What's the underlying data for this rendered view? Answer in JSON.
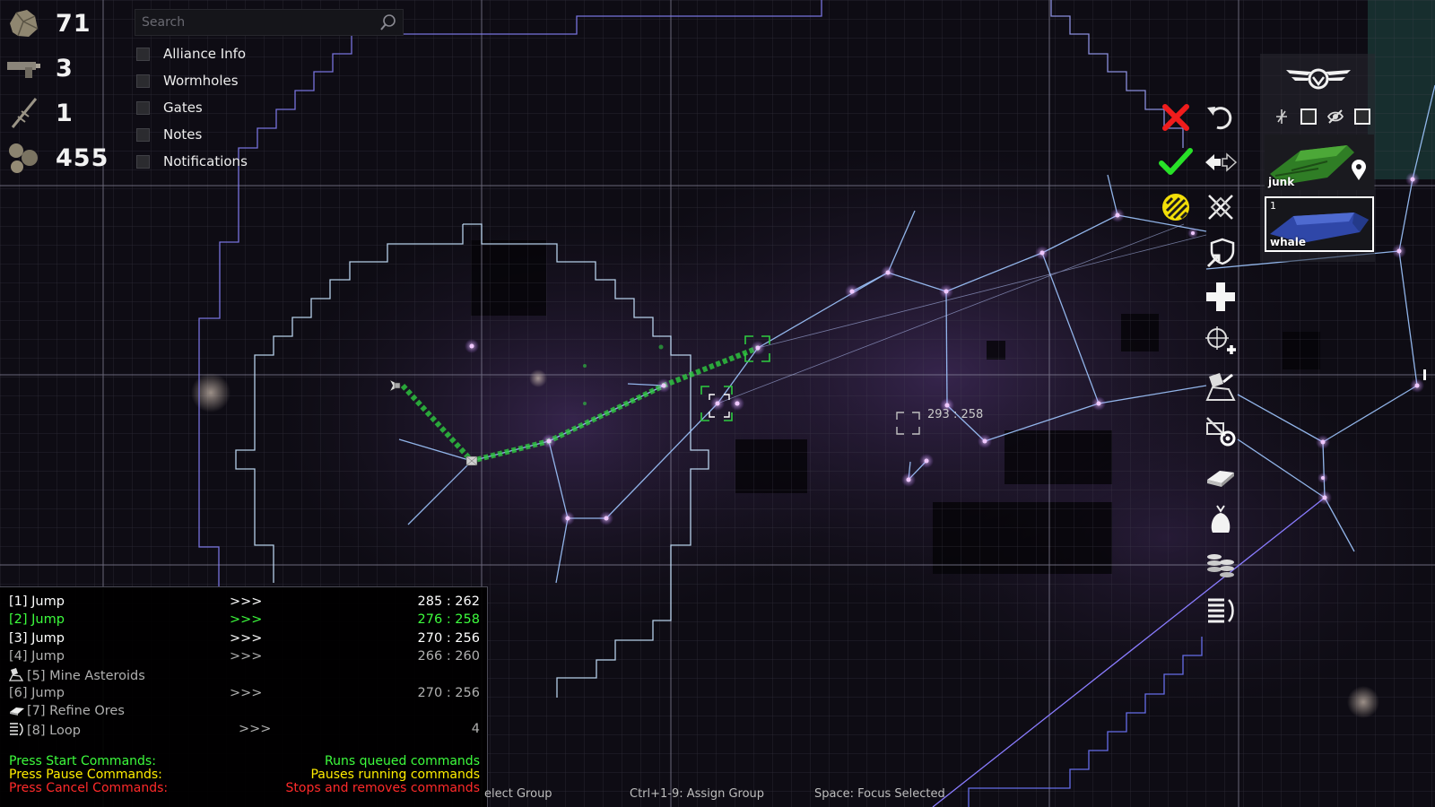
{
  "resources": [
    {
      "icon": "ore-icon",
      "value": "71"
    },
    {
      "icon": "weapon-icon",
      "value": "3"
    },
    {
      "icon": "antenna-icon",
      "value": "1"
    },
    {
      "icon": "rocks-icon",
      "value": "455"
    }
  ],
  "search": {
    "placeholder": "Search"
  },
  "filters": [
    "Alliance Info",
    "Wormholes",
    "Gates",
    "Notes",
    "Notifications"
  ],
  "commands": [
    {
      "label": "[1] Jump",
      "arrows": ">>>",
      "coords": "285 : 262",
      "color": "#ffffff",
      "icon": ""
    },
    {
      "label": "[2] Jump",
      "arrows": ">>>",
      "coords": "276 : 258",
      "color": "#3dfc3d",
      "icon": ""
    },
    {
      "label": "[3] Jump",
      "arrows": ">>>",
      "coords": "270 : 256",
      "color": "#ffffff",
      "icon": ""
    },
    {
      "label": "[4] Jump",
      "arrows": ">>>",
      "coords": "266 : 260",
      "color": "#b0b0b0",
      "icon": ""
    },
    {
      "label": "[5] Mine Asteroids",
      "arrows": "",
      "coords": "",
      "color": "#b0b0b0",
      "icon": "mine-icon"
    },
    {
      "label": "[6] Jump",
      "arrows": ">>>",
      "coords": "270 : 256",
      "color": "#b0b0b0",
      "icon": ""
    },
    {
      "label": "[7] Refine Ores",
      "arrows": "",
      "coords": "",
      "color": "#b0b0b0",
      "icon": "refine-icon"
    },
    {
      "label": "[8] Loop",
      "arrows": ">>>",
      "coords": "4",
      "color": "#b0b0b0",
      "icon": "loop-icon"
    }
  ],
  "hints": [
    {
      "left": "Press Start Commands:",
      "right": "Runs queued commands",
      "color": "#3dfc3d"
    },
    {
      "left": "Press Pause Commands:",
      "right": "Pauses running commands",
      "color": "#ffee00"
    },
    {
      "left": "Press Cancel Commands:",
      "right": "Stops and removes commands",
      "color": "#ff2a2a"
    }
  ],
  "bottom_bar": [
    "elect Group",
    "Ctrl+1-9: Assign Group",
    "Space: Focus Selected"
  ],
  "map": {
    "cursor_coords": "293 : 258"
  },
  "toolbar": [
    "cancel-icon",
    "undo-icon",
    "confirm-icon",
    "swap-direction-icon",
    "hazard-icon",
    "no-attack-icon",
    "defend-icon",
    "add-icon",
    "target-add-icon",
    "mine-icon",
    "auto-refine-icon",
    "refine-icon",
    "deposit-icon",
    "stack-icon",
    "loop-icon"
  ],
  "units": {
    "ship_label": "junk",
    "ship_icon": "location-pin-icon",
    "selected_label": "whale",
    "selected_count": "1",
    "control_icons": [
      "wrench-icon",
      "square-toggle-icon",
      "eye-off-icon",
      "square-toggle-icon"
    ],
    "emblem": "wing-emblem-icon"
  },
  "colors": {
    "route": "#2ecc40",
    "link": "#9ec8ff",
    "node": "#e8b8ff",
    "border": "#8f8fff"
  }
}
